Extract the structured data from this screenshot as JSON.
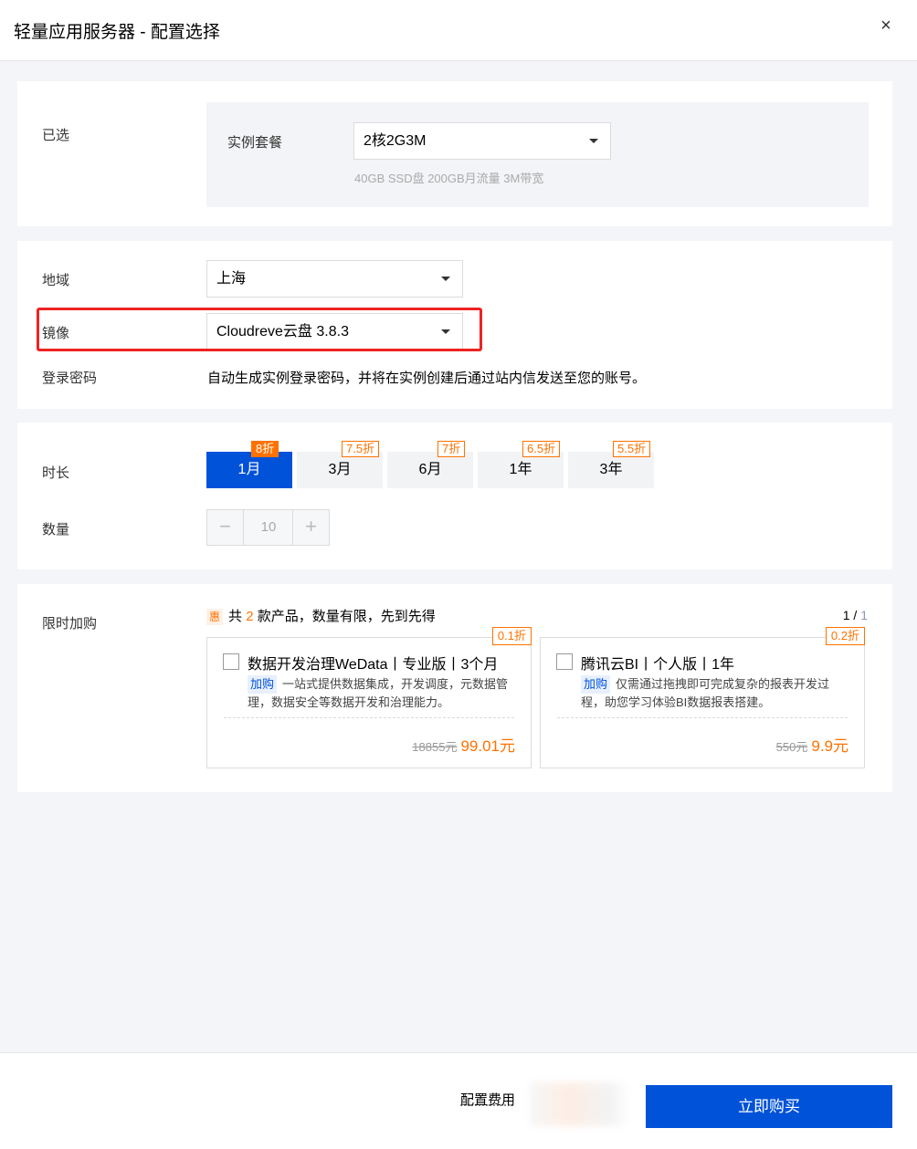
{
  "header": {
    "title": "轻量应用服务器 - 配置选择",
    "close_icon": "×"
  },
  "selected": {
    "label": "已选",
    "plan_label": "实例套餐",
    "plan_value": "2核2G3M",
    "plan_desc": "40GB SSD盘 200GB月流量 3M带宽"
  },
  "config": {
    "region_label": "地域",
    "region_value": "上海",
    "image_label": "镜像",
    "image_value": "Cloudreve云盘 3.8.3",
    "password_label": "登录密码",
    "password_text": "自动生成实例登录密码，并将在实例创建后通过站内信发送至您的账号。"
  },
  "purchase": {
    "duration_label": "时长",
    "durations": [
      {
        "label": "1月",
        "badge": "8折",
        "active": true
      },
      {
        "label": "3月",
        "badge": "7.5折",
        "active": false
      },
      {
        "label": "6月",
        "badge": "7折",
        "active": false
      },
      {
        "label": "1年",
        "badge": "6.5折",
        "active": false
      },
      {
        "label": "3年",
        "badge": "5.5折",
        "active": false
      }
    ],
    "quantity_label": "数量",
    "quantity_value": "10",
    "minus_icon": "−",
    "plus_icon": "+"
  },
  "addon": {
    "label": "限时加购",
    "hui": "惠",
    "head_prefix": "共",
    "head_count": "2",
    "head_suffix": "款产品，数量有限，先到先得",
    "page_current": "1",
    "page_sep": " / ",
    "page_total": "1",
    "products": [
      {
        "title": "数据开发治理WeData丨专业版丨3个月",
        "badge": "0.1折",
        "tag": "加购",
        "desc": "一站式提供数据集成，开发调度，元数据管理，数据安全等数据开发和治理能力。",
        "old_price": "18855元",
        "price": "99.01元"
      },
      {
        "title": "腾讯云BI丨个人版丨1年",
        "badge": "0.2折",
        "tag": "加购",
        "desc": "仅需通过拖拽即可完成复杂的报表开发过程，助您学习体验BI数据报表搭建。",
        "old_price": "550元",
        "price": "9.9元"
      }
    ]
  },
  "footer": {
    "fee_label": "配置费用",
    "buy_label": "立即购买"
  },
  "colors": {
    "primary": "#0052d9",
    "accent": "#ff7200",
    "highlight": "#ee2222"
  }
}
